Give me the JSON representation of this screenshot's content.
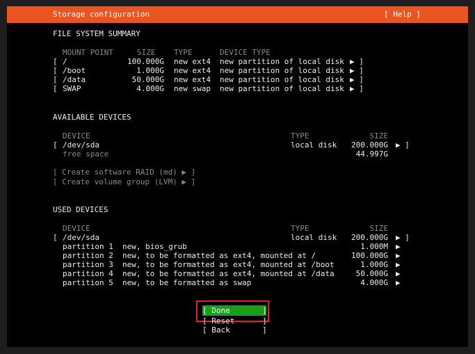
{
  "header": {
    "title": "Storage configuration",
    "help": "[ Help ]",
    "bg_color": "#e95420"
  },
  "fs_summary": {
    "title": "FILE SYSTEM SUMMARY",
    "columns": {
      "mount": "MOUNT POINT",
      "size": "SIZE",
      "type": "TYPE",
      "device_type": "DEVICE TYPE"
    },
    "rows": [
      {
        "mount": "/",
        "size": "100.000G",
        "type": "new ext4",
        "device_type": "new partition of local disk",
        "arrow": "▶ ]"
      },
      {
        "mount": "/boot",
        "size": "1.000G",
        "type": "new ext4",
        "device_type": "new partition of local disk",
        "arrow": "▶ ]"
      },
      {
        "mount": "/data",
        "size": "50.000G",
        "type": "new ext4",
        "device_type": "new partition of local disk",
        "arrow": "▶ ]"
      },
      {
        "mount": "SWAP",
        "size": "4.000G",
        "type": "new swap",
        "device_type": "new partition of local disk",
        "arrow": "▶ ]"
      }
    ]
  },
  "available": {
    "title": "AVAILABLE DEVICES",
    "columns": {
      "device": "DEVICE",
      "type": "TYPE",
      "size": "SIZE"
    },
    "device": {
      "name": "/dev/sda",
      "type": "local disk",
      "size": "200.000G",
      "arrow": "▶ ]"
    },
    "free": {
      "label": "free space",
      "size": "44.997G"
    },
    "raid": "[ Create software RAID (md) ▶ ]",
    "lvm": "[ Create volume group (LVM) ▶ ]"
  },
  "used": {
    "title": "USED DEVICES",
    "columns": {
      "device": "DEVICE",
      "type": "TYPE",
      "size": "SIZE"
    },
    "device": {
      "name": "/dev/sda",
      "type": "local disk",
      "size": "200.000G",
      "arrow": "▶ ]"
    },
    "partitions": [
      {
        "label": "partition 1",
        "desc": "new, bios_grub",
        "size": "1.000M",
        "arrow": "▶"
      },
      {
        "label": "partition 2",
        "desc": "new, to be formatted as ext4, mounted at /",
        "size": "100.000G",
        "arrow": "▶"
      },
      {
        "label": "partition 3",
        "desc": "new, to be formatted as ext4, mounted at /boot",
        "size": "1.000G",
        "arrow": "▶"
      },
      {
        "label": "partition 4",
        "desc": "new, to be formatted as ext4, mounted at /data",
        "size": "50.000G",
        "arrow": "▶"
      },
      {
        "label": "partition 5",
        "desc": "new, to be formatted as swap",
        "size": "4.000G",
        "arrow": "▶"
      }
    ]
  },
  "buttons": {
    "done": "[ Done       ]",
    "reset": "[ Reset      ]",
    "back": "[ Back       ]",
    "done_color": "#1a9e1a",
    "focus_color": "#e0202a"
  }
}
